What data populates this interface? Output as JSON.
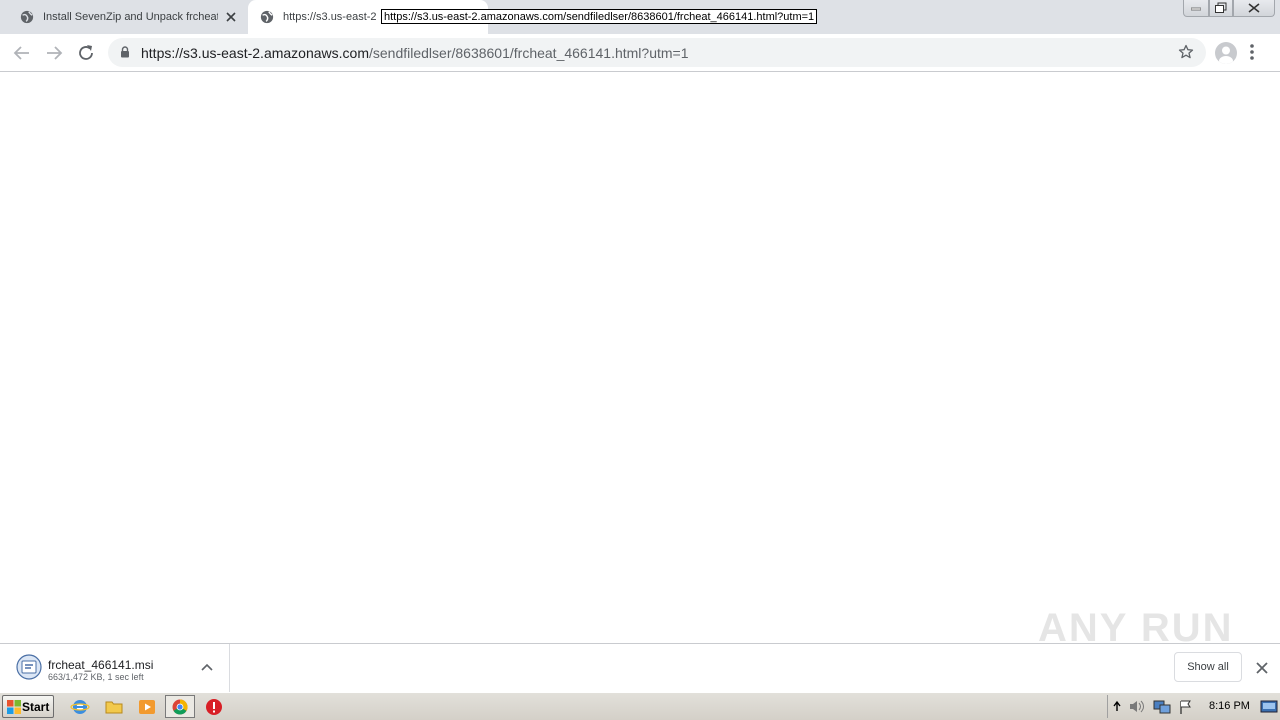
{
  "browser": {
    "tabs": [
      {
        "title": "Install SevenZip and Unpack frcheat_466141",
        "active": false
      },
      {
        "title": "https://s3.us-east-2",
        "active": true
      }
    ],
    "tooltip": "https://s3.us-east-2.amazonaws.com/sendfiledlser/8638601/frcheat_466141.html?utm=1",
    "address": {
      "host": "https://s3.us-east-2.amazonaws.com",
      "path": "/sendfiledlser/8638601/frcheat_466141.html?utm=1"
    }
  },
  "watermark": "ANY RUN",
  "download": {
    "filename": "frcheat_466141.msi",
    "status": "663/1,472 KB, 1 sec left",
    "show_all_label": "Show all"
  },
  "taskbar": {
    "start_label": "Start",
    "clock": "8:16 PM"
  },
  "icons": [
    "back-icon",
    "forward-icon",
    "reload-icon",
    "lock-icon",
    "star-icon",
    "avatar-icon",
    "menu-icon",
    "close-icon",
    "chevron-up-icon"
  ],
  "colors": {
    "tabbar": "#dee1e6",
    "omnibox": "#f1f3f4",
    "taskbar": "#d4d0c8"
  }
}
